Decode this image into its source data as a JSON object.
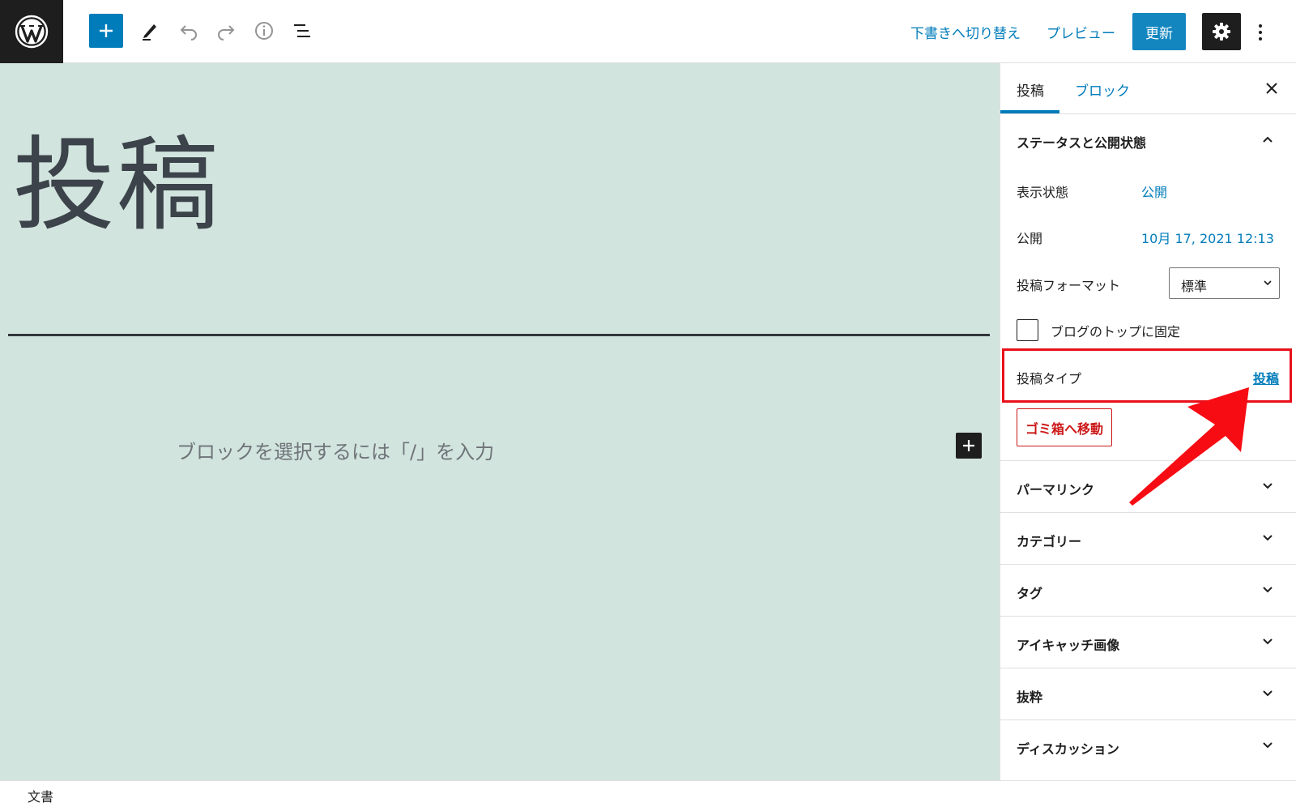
{
  "toolbar": {
    "switch_to_draft": "下書きへ切り替え",
    "preview": "プレビュー",
    "update": "更新",
    "icons": [
      "wordpress-logo",
      "plus-icon",
      "pencil-icon",
      "undo-icon",
      "redo-icon",
      "info-icon",
      "list-view-icon",
      "gear-icon",
      "more-vertical-icon"
    ]
  },
  "editor": {
    "title": "投稿",
    "placeholder": "ブロックを選択するには「/」を入力"
  },
  "sidebar": {
    "tabs": [
      {
        "label": "投稿",
        "active": true
      },
      {
        "label": "ブロック",
        "active": false
      }
    ],
    "status_panel": {
      "title": "ステータスと公開状態",
      "visibility_label": "表示状態",
      "visibility_value": "公開",
      "publish_label": "公開",
      "publish_value": "10月 17, 2021 12:13",
      "format_label": "投稿フォーマット",
      "format_value": "標準",
      "sticky_label": "ブログのトップに固定",
      "post_type_label": "投稿タイプ",
      "post_type_value": "投稿",
      "trash_label": "ゴミ箱へ移動"
    },
    "panels": [
      {
        "title": "パーマリンク"
      },
      {
        "title": "カテゴリー"
      },
      {
        "title": "タグ"
      },
      {
        "title": "アイキャッチ画像"
      },
      {
        "title": "抜粋"
      },
      {
        "title": "ディスカッション"
      }
    ]
  },
  "footer": {
    "breadcrumb": "文書"
  },
  "colors": {
    "accent": "#007cba",
    "canvas": "#d2e4de",
    "danger": "#cc1818",
    "annotation": "#e8101a"
  }
}
